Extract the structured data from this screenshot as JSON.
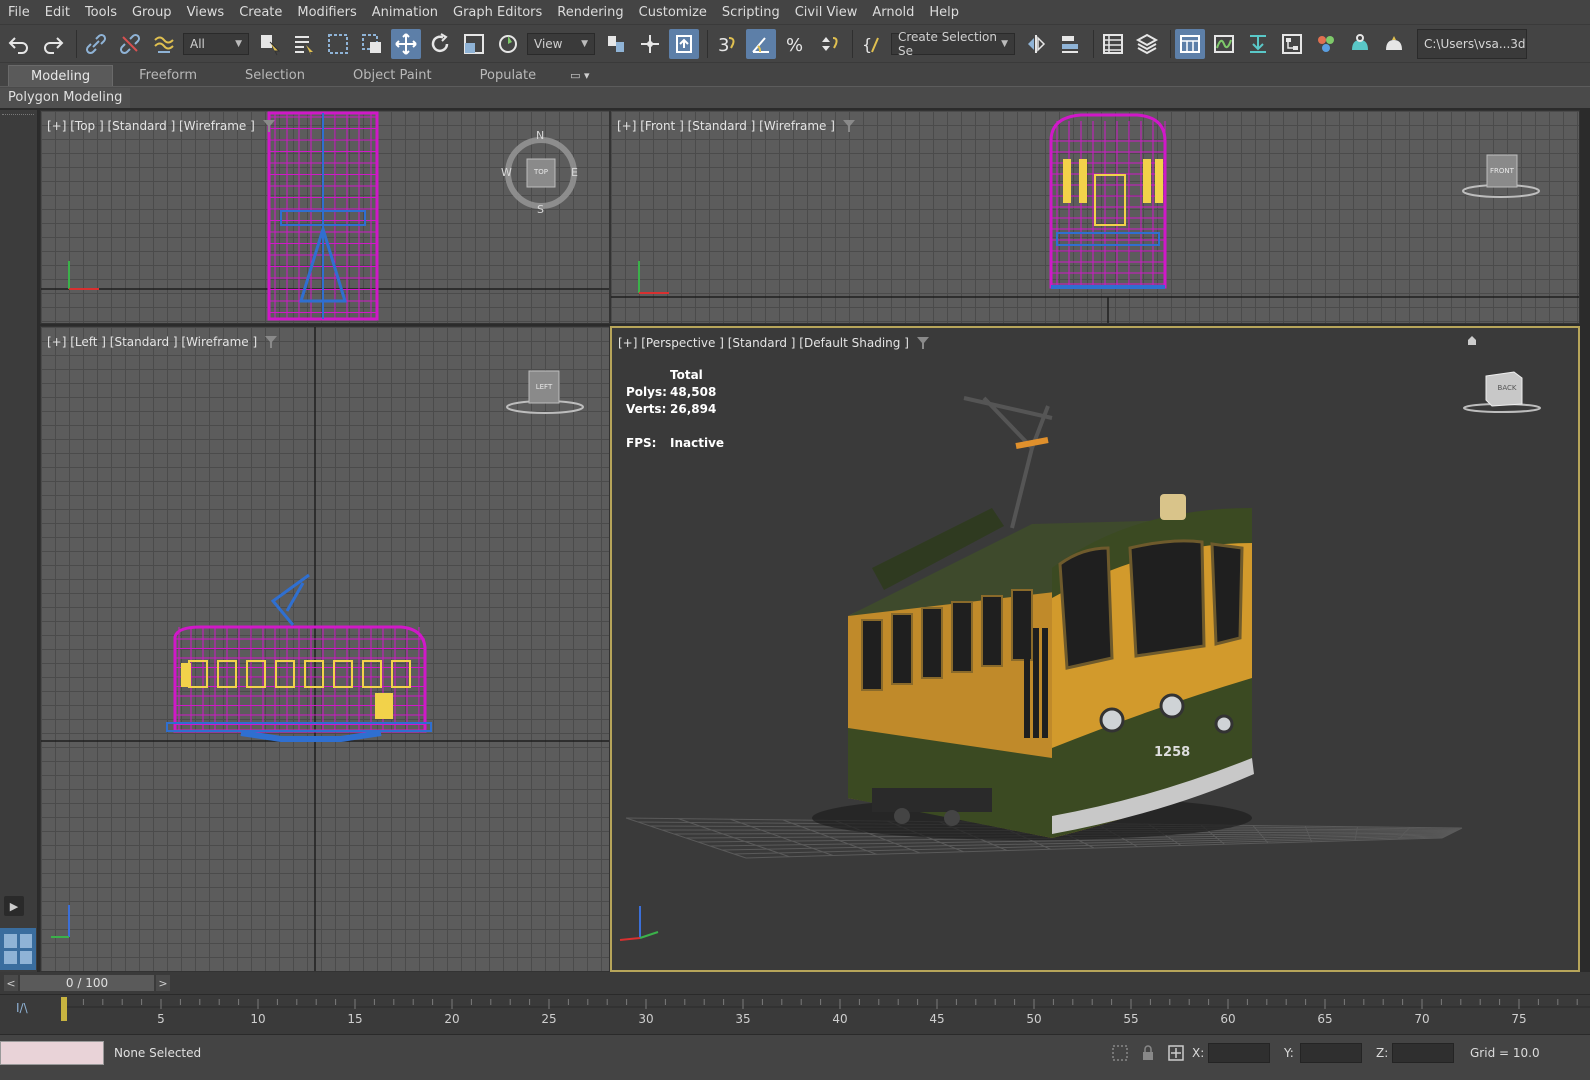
{
  "menu": [
    "File",
    "Edit",
    "Tools",
    "Group",
    "Views",
    "Create",
    "Modifiers",
    "Animation",
    "Graph Editors",
    "Rendering",
    "Customize",
    "Scripting",
    "Civil View",
    "Arnold",
    "Help"
  ],
  "toolbar": {
    "selection_filter": "All",
    "ref_coord": "View",
    "named_selection": "Create Selection Se",
    "project_path": "C:\\Users\\vsa...3ds",
    "icons": [
      "undo-icon",
      "redo-icon",
      "link-icon",
      "unlink-icon",
      "bind-spacewarp-icon",
      "select-object-icon",
      "select-by-name-icon",
      "rect-selection-icon",
      "window-crossing-icon",
      "move-icon",
      "rotate-icon",
      "scale-icon",
      "placement-icon",
      "pivot-icon",
      "snap-3d-icon",
      "angle-snap-icon",
      "percent-snap-icon",
      "spinner-snap-icon",
      "mirror-icon",
      "align-icon",
      "scene-explorer-icon",
      "layer-explorer-icon",
      "ribbon-toggle-icon",
      "curve-editor-icon",
      "schematic-icon",
      "material-editor-icon",
      "render-setup-icon",
      "rendered-frame-icon",
      "render-icon"
    ]
  },
  "ribbon": {
    "tabs": [
      "Modeling",
      "Freeform",
      "Selection",
      "Object Paint",
      "Populate"
    ],
    "active_tab": "Modeling",
    "panel_label": "Polygon Modeling"
  },
  "viewports": {
    "top": {
      "label": "[+] [Top ] [Standard ] [Wireframe ]",
      "compass": {
        "n": "N",
        "s": "S",
        "e": "E",
        "w": "W",
        "cube": "TOP"
      }
    },
    "front": {
      "label": "[+] [Front ] [Standard ] [Wireframe ]",
      "cube": "FRONT"
    },
    "left": {
      "label": "[+] [Left ] [Standard ] [Wireframe ]",
      "cube": "LEFT"
    },
    "perspective": {
      "label": "[+] [Perspective ] [Standard ] [Default Shading ]",
      "cube": "BACK",
      "stats": {
        "header": "Total",
        "polys_label": "Polys:",
        "polys": "48,508",
        "verts_label": "Verts:",
        "verts": "26,894",
        "fps_label": "FPS:",
        "fps": "Inactive"
      },
      "tram_number": "1258"
    }
  },
  "timeline": {
    "slider": "0 / 100",
    "prev": "<",
    "next": ">",
    "ticks": [
      "5",
      "10",
      "15",
      "20",
      "25",
      "30",
      "35",
      "40",
      "45",
      "50",
      "55",
      "60",
      "65",
      "70",
      "75"
    ],
    "current_frame": 0,
    "max_visible_frame": 78
  },
  "status": {
    "selection": "None Selected",
    "x_label": "X:",
    "y_label": "Y:",
    "z_label": "Z:",
    "grid": "Grid = 10.0"
  },
  "colors": {
    "wire_magenta": "#d018c8",
    "wire_blue": "#2f6fd0",
    "wire_yellow": "#f2d24a",
    "tram_green": "#3b4a22",
    "tram_yellow": "#d29a2c",
    "active_border": "#b7a55a"
  }
}
